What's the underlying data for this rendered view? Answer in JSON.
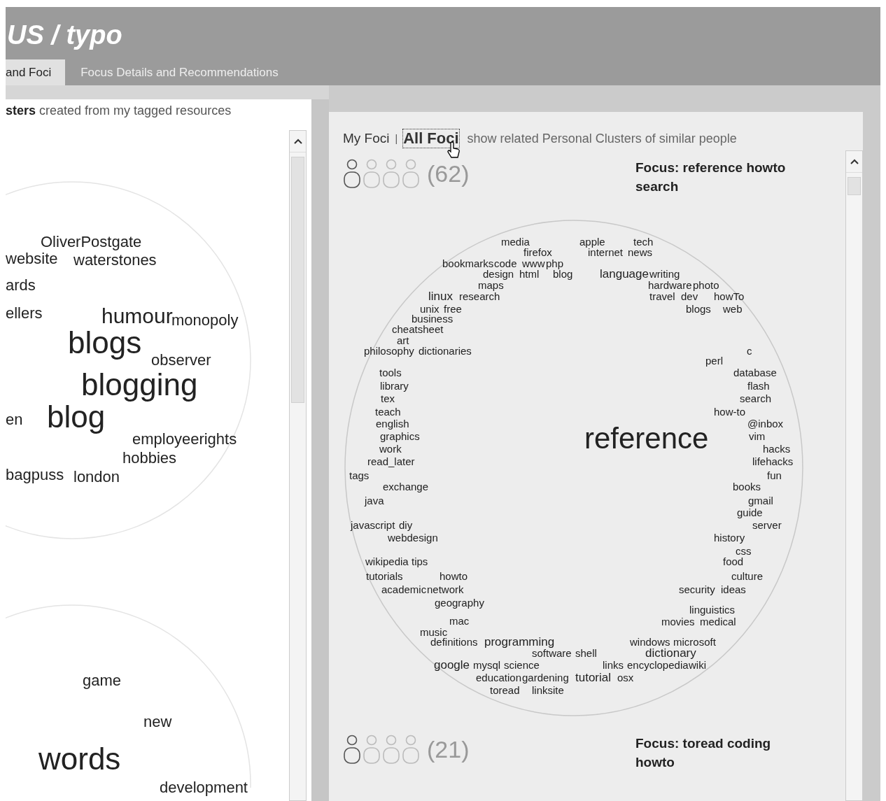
{
  "header": {
    "title": "US / typo"
  },
  "tabs": [
    {
      "label": "and Foci",
      "selected": true
    },
    {
      "label": "Focus Details and Recommendations",
      "selected": false
    }
  ],
  "left_panel": {
    "caption": "**sters** created from my tagged resources",
    "clouds": [
      {
        "tags": [
          {
            "text": "OliverPostgate",
            "kind": "mid"
          },
          {
            "text": "website",
            "kind": "mid"
          },
          {
            "text": "waterstones",
            "kind": "mid"
          },
          {
            "text": "ards",
            "kind": "mid"
          },
          {
            "text": "ellers",
            "kind": "mid"
          },
          {
            "text": "humour",
            "kind": "big"
          },
          {
            "text": "monopoly",
            "kind": "mid"
          },
          {
            "text": "blogs",
            "kind": "huge"
          },
          {
            "text": "observer",
            "kind": "mid"
          },
          {
            "text": "blogging",
            "kind": "huge"
          },
          {
            "text": "en",
            "kind": "mid"
          },
          {
            "text": "blog",
            "kind": "huge"
          },
          {
            "text": "employeerights",
            "kind": "mid"
          },
          {
            "text": "hobbies",
            "kind": "mid"
          },
          {
            "text": "bagpuss",
            "kind": "mid"
          },
          {
            "text": "london",
            "kind": "mid"
          }
        ]
      },
      {
        "tags": [
          {
            "text": "game",
            "kind": "mid"
          },
          {
            "text": "new",
            "kind": "mid"
          },
          {
            "text": "words",
            "kind": "huge"
          },
          {
            "text": "development",
            "kind": "mid"
          }
        ]
      }
    ]
  },
  "right_panel": {
    "links": [
      {
        "label": "My Foci",
        "selected": false
      },
      {
        "label": "All Foci",
        "selected": true
      }
    ],
    "separator": "|",
    "hint": "show related Personal Clusters of similar people",
    "foci": [
      {
        "people": [
          {
            "selected": true
          },
          {
            "selected": false
          },
          {
            "selected": false
          },
          {
            "selected": false
          }
        ],
        "count": "(62)",
        "title": "Focus: reference howto search",
        "tags": [
          {
            "text": "media",
            "kind": "small"
          },
          {
            "text": "apple",
            "kind": "small"
          },
          {
            "text": "tech",
            "kind": "small"
          },
          {
            "text": "firefox",
            "kind": "small"
          },
          {
            "text": "internet",
            "kind": "small"
          },
          {
            "text": "news",
            "kind": "small"
          },
          {
            "text": "bookmarks",
            "kind": "small"
          },
          {
            "text": "code",
            "kind": "small"
          },
          {
            "text": "www",
            "kind": "small"
          },
          {
            "text": "php",
            "kind": "small"
          },
          {
            "text": "design",
            "kind": "small"
          },
          {
            "text": "html",
            "kind": "small"
          },
          {
            "text": "blog",
            "kind": "small"
          },
          {
            "text": "language",
            "kind": "medium"
          },
          {
            "text": "writing",
            "kind": "small"
          },
          {
            "text": "maps",
            "kind": "small"
          },
          {
            "text": "hardware",
            "kind": "small"
          },
          {
            "text": "photo",
            "kind": "small"
          },
          {
            "text": "linux",
            "kind": "medium"
          },
          {
            "text": "research",
            "kind": "small"
          },
          {
            "text": "travel",
            "kind": "small"
          },
          {
            "text": "dev",
            "kind": "small"
          },
          {
            "text": "howTo",
            "kind": "small"
          },
          {
            "text": "unix",
            "kind": "small"
          },
          {
            "text": "free",
            "kind": "small"
          },
          {
            "text": "blogs",
            "kind": "small"
          },
          {
            "text": "web",
            "kind": "small"
          },
          {
            "text": "business",
            "kind": "small"
          },
          {
            "text": "cheatsheet",
            "kind": "small"
          },
          {
            "text": "art",
            "kind": "small"
          },
          {
            "text": "philosophy",
            "kind": "small"
          },
          {
            "text": "dictionaries",
            "kind": "small"
          },
          {
            "text": "c",
            "kind": "small"
          },
          {
            "text": "perl",
            "kind": "small"
          },
          {
            "text": "tools",
            "kind": "small"
          },
          {
            "text": "database",
            "kind": "small"
          },
          {
            "text": "library",
            "kind": "small"
          },
          {
            "text": "flash",
            "kind": "small"
          },
          {
            "text": "tex",
            "kind": "small"
          },
          {
            "text": "search",
            "kind": "small"
          },
          {
            "text": "teach",
            "kind": "small"
          },
          {
            "text": "how-to",
            "kind": "small"
          },
          {
            "text": "english",
            "kind": "small"
          },
          {
            "text": "@inbox",
            "kind": "small"
          },
          {
            "text": "graphics",
            "kind": "small"
          },
          {
            "text": "reference",
            "kind": "huge"
          },
          {
            "text": "vim",
            "kind": "small"
          },
          {
            "text": "work",
            "kind": "small"
          },
          {
            "text": "hacks",
            "kind": "small"
          },
          {
            "text": "read_later",
            "kind": "small"
          },
          {
            "text": "lifehacks",
            "kind": "small"
          },
          {
            "text": "tags",
            "kind": "small"
          },
          {
            "text": "fun",
            "kind": "small"
          },
          {
            "text": "exchange",
            "kind": "small"
          },
          {
            "text": "books",
            "kind": "small"
          },
          {
            "text": "java",
            "kind": "small"
          },
          {
            "text": "gmail",
            "kind": "small"
          },
          {
            "text": "guide",
            "kind": "small"
          },
          {
            "text": "javascript",
            "kind": "small"
          },
          {
            "text": "diy",
            "kind": "small"
          },
          {
            "text": "server",
            "kind": "small"
          },
          {
            "text": "webdesign",
            "kind": "small"
          },
          {
            "text": "history",
            "kind": "small"
          },
          {
            "text": "css",
            "kind": "small"
          },
          {
            "text": "wikipedia",
            "kind": "small"
          },
          {
            "text": "tips",
            "kind": "small"
          },
          {
            "text": "food",
            "kind": "small"
          },
          {
            "text": "tutorials",
            "kind": "small"
          },
          {
            "text": "howto",
            "kind": "small"
          },
          {
            "text": "culture",
            "kind": "small"
          },
          {
            "text": "academic",
            "kind": "small"
          },
          {
            "text": "network",
            "kind": "small"
          },
          {
            "text": "security",
            "kind": "small"
          },
          {
            "text": "ideas",
            "kind": "small"
          },
          {
            "text": "geography",
            "kind": "small"
          },
          {
            "text": "linguistics",
            "kind": "small"
          },
          {
            "text": "mac",
            "kind": "small"
          },
          {
            "text": "movies",
            "kind": "small"
          },
          {
            "text": "medical",
            "kind": "small"
          },
          {
            "text": "music",
            "kind": "small"
          },
          {
            "text": "definitions",
            "kind": "small"
          },
          {
            "text": "programming",
            "kind": "medium"
          },
          {
            "text": "windows",
            "kind": "small"
          },
          {
            "text": "microsoft",
            "kind": "small"
          },
          {
            "text": "software",
            "kind": "small"
          },
          {
            "text": "shell",
            "kind": "small"
          },
          {
            "text": "dictionary",
            "kind": "medium"
          },
          {
            "text": "google",
            "kind": "medium"
          },
          {
            "text": "mysql",
            "kind": "small"
          },
          {
            "text": "science",
            "kind": "small"
          },
          {
            "text": "links",
            "kind": "small"
          },
          {
            "text": "encyclopedia",
            "kind": "small"
          },
          {
            "text": "wiki",
            "kind": "small"
          },
          {
            "text": "education",
            "kind": "small"
          },
          {
            "text": "gardening",
            "kind": "small"
          },
          {
            "text": "tutorial",
            "kind": "medium"
          },
          {
            "text": "osx",
            "kind": "small"
          },
          {
            "text": "toread",
            "kind": "small"
          },
          {
            "text": "linksite",
            "kind": "small"
          }
        ]
      },
      {
        "people": [
          {
            "selected": true
          },
          {
            "selected": false
          },
          {
            "selected": false
          },
          {
            "selected": false
          }
        ],
        "count": "(21)",
        "title": "Focus: toread coding howto"
      }
    ]
  }
}
